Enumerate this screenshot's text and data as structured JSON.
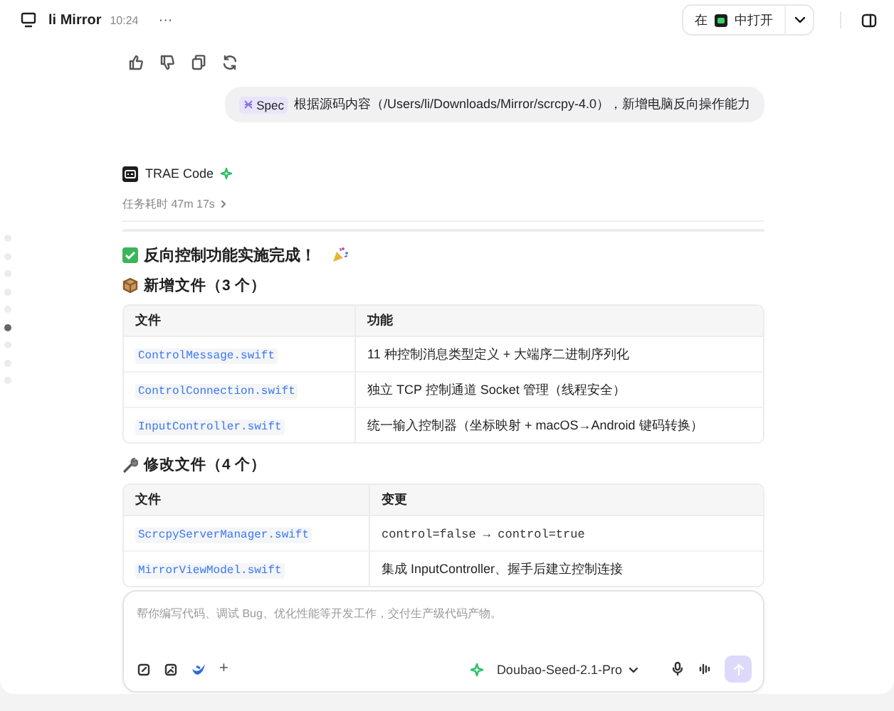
{
  "header": {
    "title": "li Mirror",
    "time": "10:24",
    "more": "···",
    "open_prefix": "在",
    "open_suffix": "中打开"
  },
  "user_message": {
    "tag": "Spec",
    "text": "根据源码内容（/Users/li/Downloads/Mirror/scrcpy-4.0），新增电脑反向操作能力"
  },
  "agent": {
    "name": "TRAE Code",
    "duration": "任务耗时 47m 17s"
  },
  "result_title": "反向控制功能实施完成！",
  "sections": [
    {
      "kind": "added",
      "heading": "新增文件（3 个）",
      "columns": [
        "文件",
        "功能"
      ],
      "rows": [
        {
          "file": "ControlMessage.swift",
          "desc": "11 种控制消息类型定义 + 大端序二进制序列化",
          "kind": "text"
        },
        {
          "file": "ControlConnection.swift",
          "desc": "独立 TCP 控制通道 Socket 管理（线程安全）",
          "kind": "text"
        },
        {
          "file": "InputController.swift",
          "desc": "统一输入控制器（坐标映射 + macOS→Android 键码转换）",
          "kind": "text"
        }
      ]
    },
    {
      "kind": "modified",
      "heading": "修改文件（4 个）",
      "columns": [
        "文件",
        "变更"
      ],
      "rows": [
        {
          "file": "ScrcpyServerManager.swift",
          "desc": "control=false → control=true",
          "kind": "code"
        },
        {
          "file": "MirrorViewModel.swift",
          "desc": "集成 InputController、握手后建立控制连接",
          "kind": "text"
        }
      ]
    }
  ],
  "composer": {
    "placeholder": "帮你编写代码、调试 Bug、优化性能等开发工作，交付生产级代码产物。",
    "add": "+",
    "model": "Doubao-Seed-2.1-Pro"
  },
  "nav_dots": [
    {
      "selected": false
    },
    {
      "selected": false
    },
    {
      "selected": false
    },
    {
      "selected": false
    },
    {
      "selected": false
    },
    {
      "selected": true
    },
    {
      "selected": false
    },
    {
      "selected": false
    },
    {
      "selected": false
    }
  ]
}
